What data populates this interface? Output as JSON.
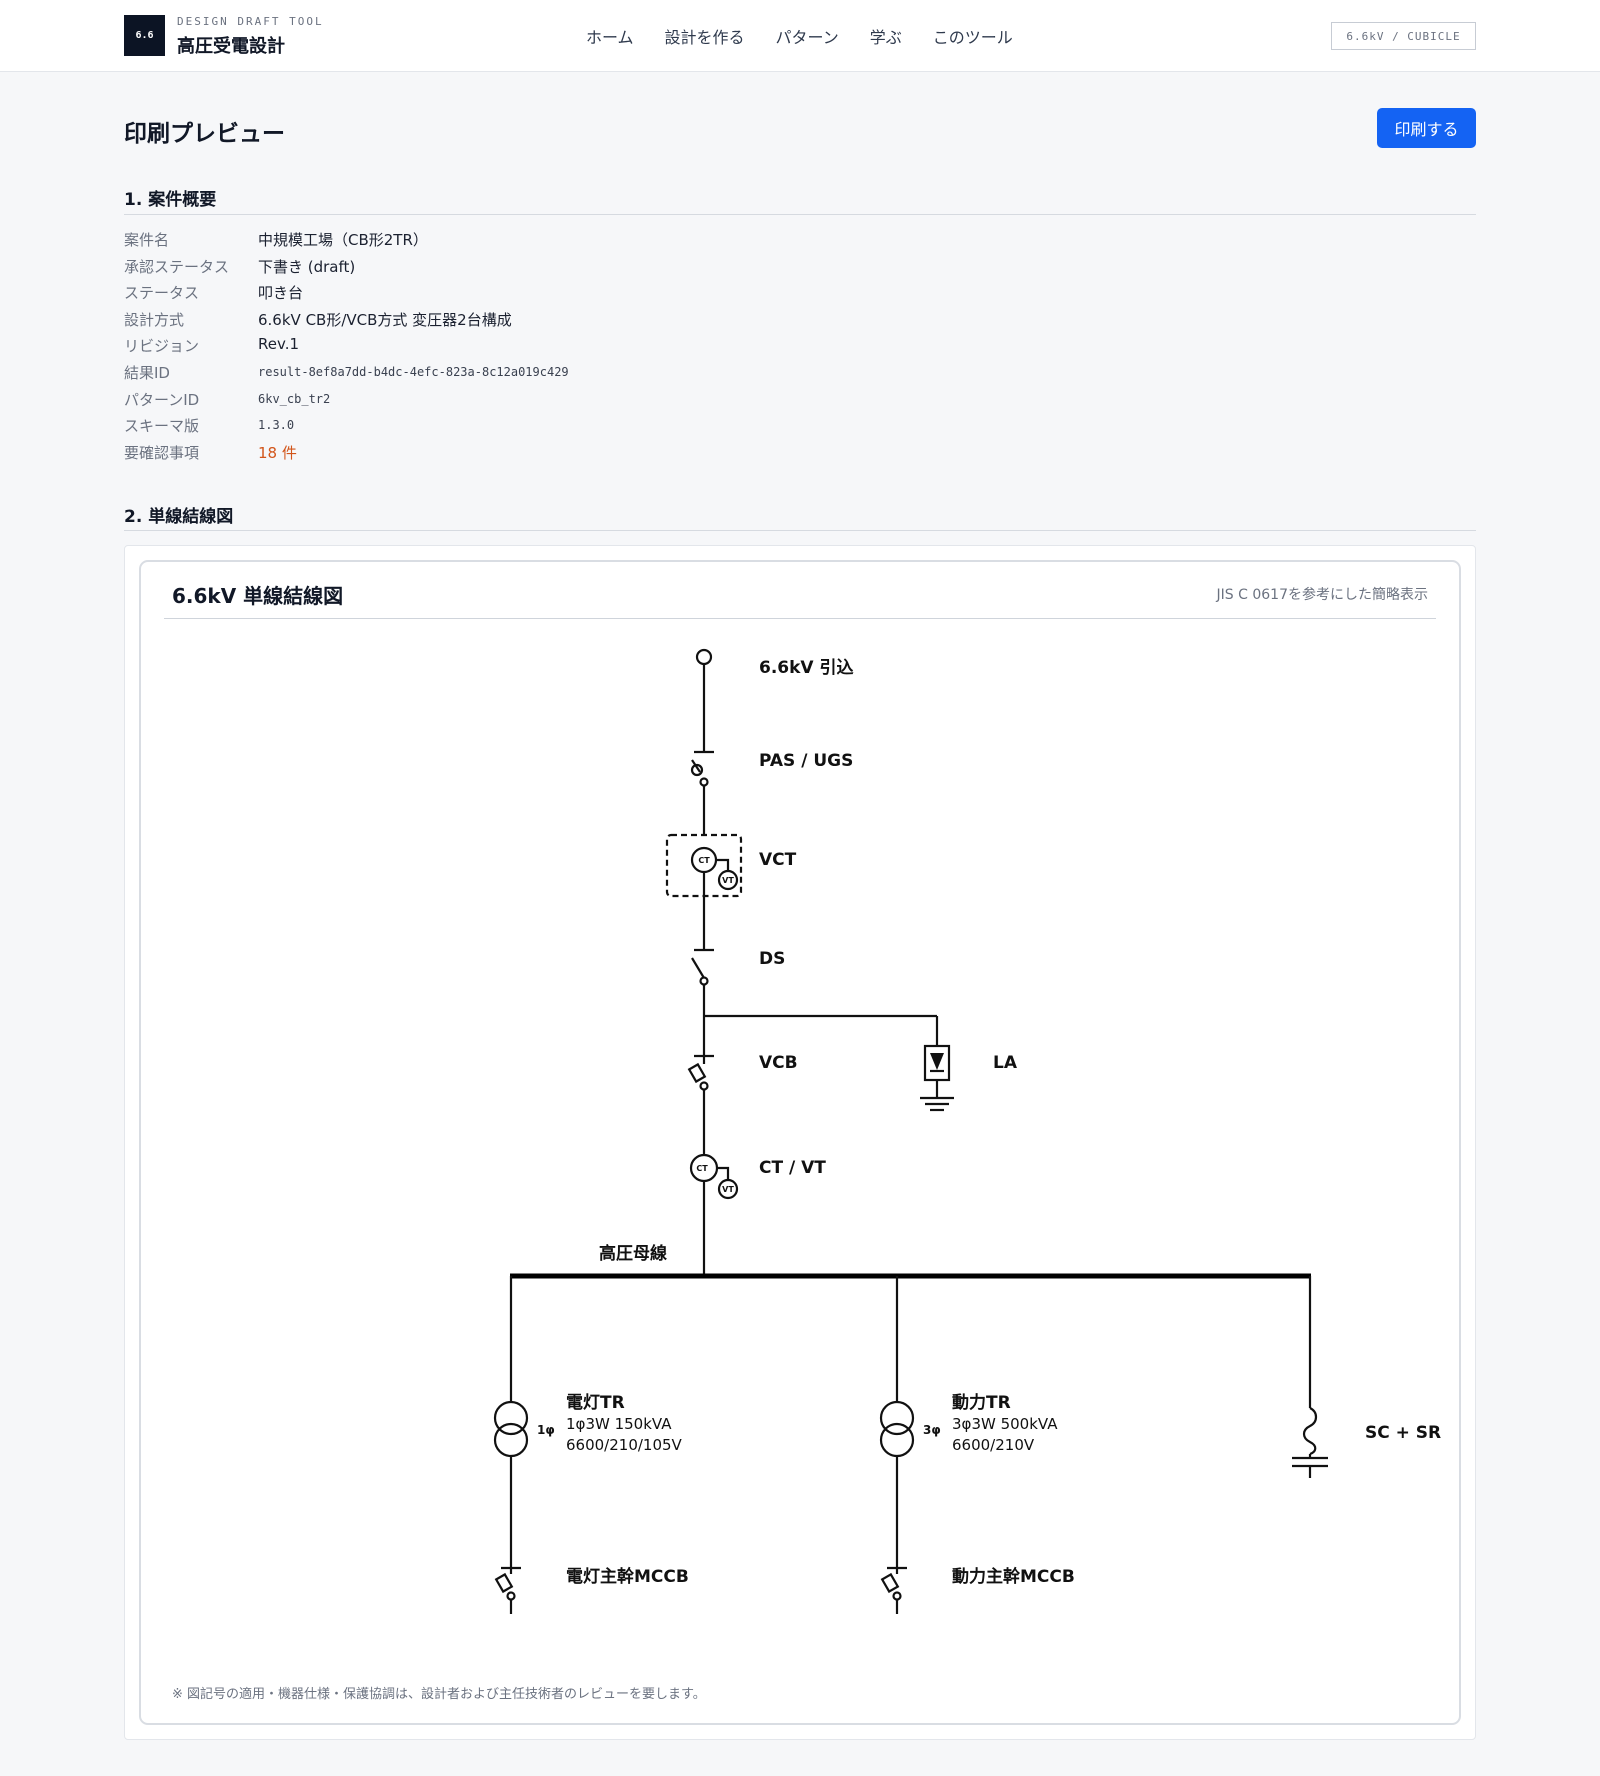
{
  "header": {
    "logo_text": "6.6",
    "brand_sub": "DESIGN DRAFT TOOL",
    "brand_title": "高圧受電設計",
    "nav": [
      "ホーム",
      "設計を作る",
      "パターン",
      "学ぶ",
      "このツール"
    ],
    "badge": "6.6kV / CUBICLE"
  },
  "page": {
    "title": "印刷プレビュー",
    "print_label": "印刷する"
  },
  "summary": {
    "heading": "1. 案件概要",
    "rows": [
      {
        "label": "案件名",
        "value": "中規模工場（CB形2TR）"
      },
      {
        "label": "承認ステータス",
        "value": "下書き (draft)"
      },
      {
        "label": "ステータス",
        "value": "叩き台"
      },
      {
        "label": "設計方式",
        "value": "6.6kV CB形/VCB方式 変圧器2台構成"
      },
      {
        "label": "リビジョン",
        "value": "Rev.1"
      },
      {
        "label": "結果ID",
        "value": "result-8ef8a7dd-b4dc-4efc-823a-8c12a019c429"
      },
      {
        "label": "パターンID",
        "value": "6kv_cb_tr2"
      },
      {
        "label": "スキーマ版",
        "value": "1.3.0"
      },
      {
        "label": "要確認事項",
        "value": "18 件"
      }
    ]
  },
  "diagram": {
    "heading": "2. 単線結線図",
    "title": "6.6kV 単線結線図",
    "reference": "JIS C 0617を参考にした簡略表示",
    "note": "※ 図記号の適用・機器仕様・保護協調は、設計者および主任技術者のレビューを要します。",
    "labels": {
      "incoming": "6.6kV 引込",
      "pas": "PAS / UGS",
      "vct": "VCT",
      "ds": "DS",
      "vcb": "VCB",
      "la": "LA",
      "ctvt": "CT / VT",
      "bus": "高圧母線",
      "tr1_name": "電灯TR",
      "tr1_spec1": "1φ3W 150kVA",
      "tr1_spec2": "6600/210/105V",
      "tr1_phase": "1φ",
      "tr2_name": "動力TR",
      "tr2_spec1": "3φ3W 500kVA",
      "tr2_spec2": "6600/210V",
      "tr2_phase": "3φ",
      "sc": "SC + SR",
      "mccb1": "電灯主幹MCCB",
      "mccb2": "動力主幹MCCB",
      "ct": "CT",
      "vt": "VT"
    }
  },
  "colors": {
    "accent": "#1463f3",
    "warning": "#d2551a",
    "logo_bg": "#0c1424"
  }
}
